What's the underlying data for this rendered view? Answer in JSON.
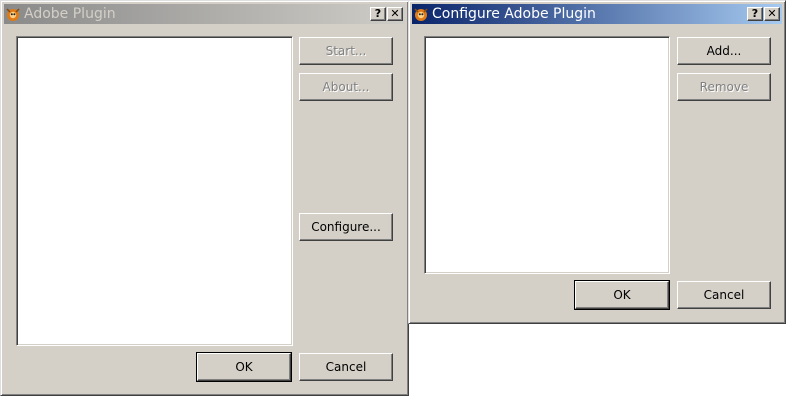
{
  "left_dialog": {
    "title": "Adobe Plugin",
    "icon": "gimp-icon",
    "help_label": "?",
    "close_label": "✕",
    "buttons": {
      "start": "Start...",
      "about": "About...",
      "configure": "Configure...",
      "ok": "OK",
      "cancel": "Cancel"
    }
  },
  "right_dialog": {
    "title": "Configure Adobe Plugin",
    "icon": "gimp-icon",
    "help_label": "?",
    "close_label": "✕",
    "buttons": {
      "add": "Add...",
      "remove": "Remove",
      "ok": "OK",
      "cancel": "Cancel"
    }
  },
  "colors": {
    "active_title_start": "#0a246a",
    "active_title_end": "#a6caf0",
    "inactive_title_start": "#8a8a8a",
    "inactive_title_end": "#cfcdc7",
    "window_face": "#d4d0c8"
  }
}
